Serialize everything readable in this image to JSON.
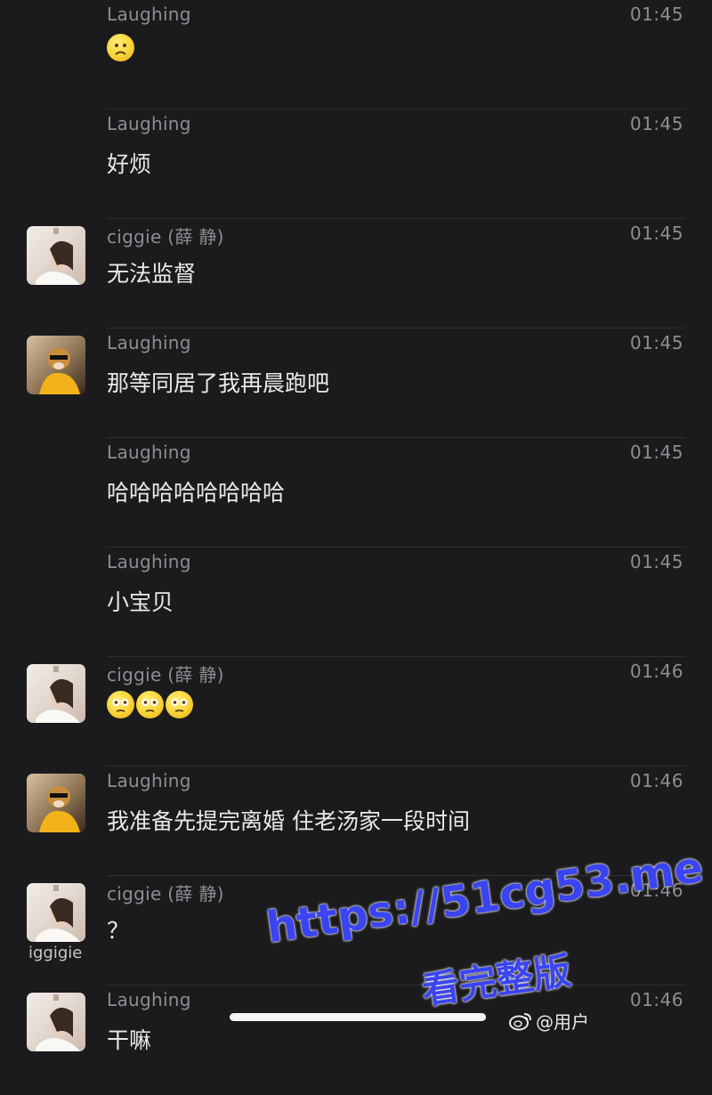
{
  "messages": [
    {
      "sender": "Laughing",
      "time": "01:45",
      "text": "",
      "avatar": "none",
      "emojis": [
        "frowning-face"
      ]
    },
    {
      "sender": "Laughing",
      "time": "01:45",
      "text": "好烦",
      "avatar": "none",
      "emojis": []
    },
    {
      "sender": "ciggie (薛 静)",
      "time": "01:45",
      "text": "无法监督",
      "avatar": "girl",
      "emojis": []
    },
    {
      "sender": "Laughing",
      "time": "01:45",
      "text": "那等同居了我再晨跑吧",
      "avatar": "dog",
      "emojis": []
    },
    {
      "sender": "Laughing",
      "time": "01:45",
      "text": "哈哈哈哈哈哈哈哈",
      "avatar": "none",
      "emojis": []
    },
    {
      "sender": "Laughing",
      "time": "01:45",
      "text": "小宝贝",
      "avatar": "none",
      "emojis": []
    },
    {
      "sender": "ciggie (薛 静)",
      "time": "01:46",
      "text": "",
      "avatar": "girl",
      "emojis": [
        "flushed-face",
        "flushed-face",
        "flushed-face"
      ]
    },
    {
      "sender": "Laughing",
      "time": "01:46",
      "text": "我准备先提完离婚 住老汤家一段时间",
      "avatar": "dog",
      "emojis": []
    },
    {
      "sender": "ciggie (薛 静)",
      "time": "01:46",
      "text": "？",
      "avatar": "girl",
      "emojis": []
    },
    {
      "sender": "Laughing",
      "time": "01:46",
      "text": "干嘛",
      "avatar": "girl",
      "emojis": []
    }
  ],
  "ghost_name": "iggigie",
  "watermark": {
    "url": "https://51cg53.me",
    "subtitle": "看完整版",
    "weibo_handle": "@用户"
  },
  "colors": {
    "background": "#1b1b1d",
    "text_primary": "#e9e9ea",
    "text_secondary": "#8d8d92",
    "divider": "#2f2f33",
    "watermark": "#3a44f0"
  }
}
